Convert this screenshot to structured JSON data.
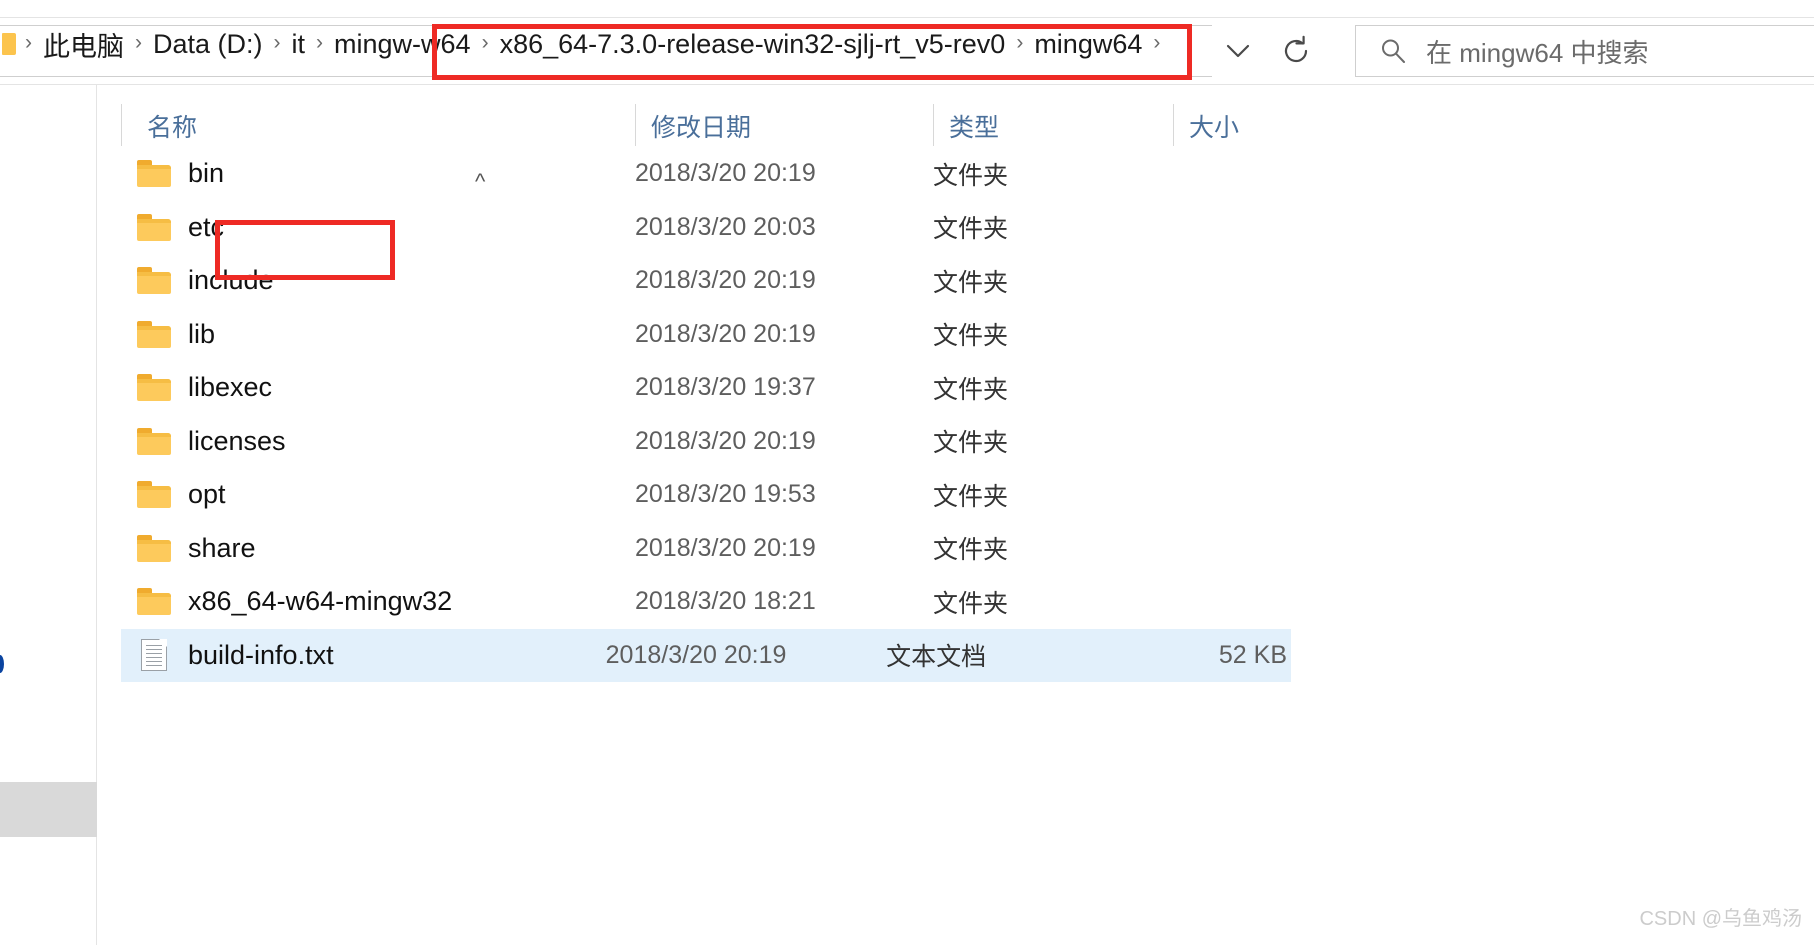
{
  "window": {
    "app": "file-explorer",
    "accent_highlight_color": "#ee2a24",
    "selection_color": "#e2f0fb"
  },
  "address_bar": {
    "breadcrumbs": [
      {
        "label": "此电脑"
      },
      {
        "label": "Data (D:)"
      },
      {
        "label": "it"
      },
      {
        "label": "mingw-w64"
      },
      {
        "label": "x86_64-7.3.0-release-win32-sjlj-rt_v5-rev0"
      },
      {
        "label": "mingw64"
      }
    ],
    "separator": "›",
    "history_dropdown_icon": "chevron-down-icon",
    "refresh_icon": "refresh-icon"
  },
  "search": {
    "icon": "search-icon",
    "placeholder": "在 mingw64 中搜索"
  },
  "columns": [
    {
      "key": "name",
      "label": "名称"
    },
    {
      "key": "date",
      "label": "修改日期"
    },
    {
      "key": "type",
      "label": "类型"
    },
    {
      "key": "size",
      "label": "大小"
    }
  ],
  "sort": {
    "column": "名称",
    "direction": "ascending",
    "caret": "^"
  },
  "rows": [
    {
      "name": "bin",
      "date": "2018/3/20 20:19",
      "type": "文件夹",
      "size": "",
      "icon": "folder-icon",
      "selected": false,
      "highlighted": true
    },
    {
      "name": "etc",
      "date": "2018/3/20 20:03",
      "type": "文件夹",
      "size": "",
      "icon": "folder-icon",
      "selected": false,
      "highlighted": false
    },
    {
      "name": "include",
      "date": "2018/3/20 20:19",
      "type": "文件夹",
      "size": "",
      "icon": "folder-icon",
      "selected": false,
      "highlighted": false
    },
    {
      "name": "lib",
      "date": "2018/3/20 20:19",
      "type": "文件夹",
      "size": "",
      "icon": "folder-icon",
      "selected": false,
      "highlighted": false
    },
    {
      "name": "libexec",
      "date": "2018/3/20 19:37",
      "type": "文件夹",
      "size": "",
      "icon": "folder-icon",
      "selected": false,
      "highlighted": false
    },
    {
      "name": "licenses",
      "date": "2018/3/20 20:19",
      "type": "文件夹",
      "size": "",
      "icon": "folder-icon",
      "selected": false,
      "highlighted": false
    },
    {
      "name": "opt",
      "date": "2018/3/20 19:53",
      "type": "文件夹",
      "size": "",
      "icon": "folder-icon",
      "selected": false,
      "highlighted": false
    },
    {
      "name": "share",
      "date": "2018/3/20 20:19",
      "type": "文件夹",
      "size": "",
      "icon": "folder-icon",
      "selected": false,
      "highlighted": false
    },
    {
      "name": "x86_64-w64-mingw32",
      "date": "2018/3/20 18:21",
      "type": "文件夹",
      "size": "",
      "icon": "folder-icon",
      "selected": false,
      "highlighted": false
    },
    {
      "name": "build-info.txt",
      "date": "2018/3/20 20:19",
      "type": "文本文档",
      "size": "52 KB",
      "icon": "text-file-icon",
      "selected": true,
      "highlighted": false
    }
  ],
  "watermark": {
    "text": "CSDN @乌鱼鸡汤"
  }
}
